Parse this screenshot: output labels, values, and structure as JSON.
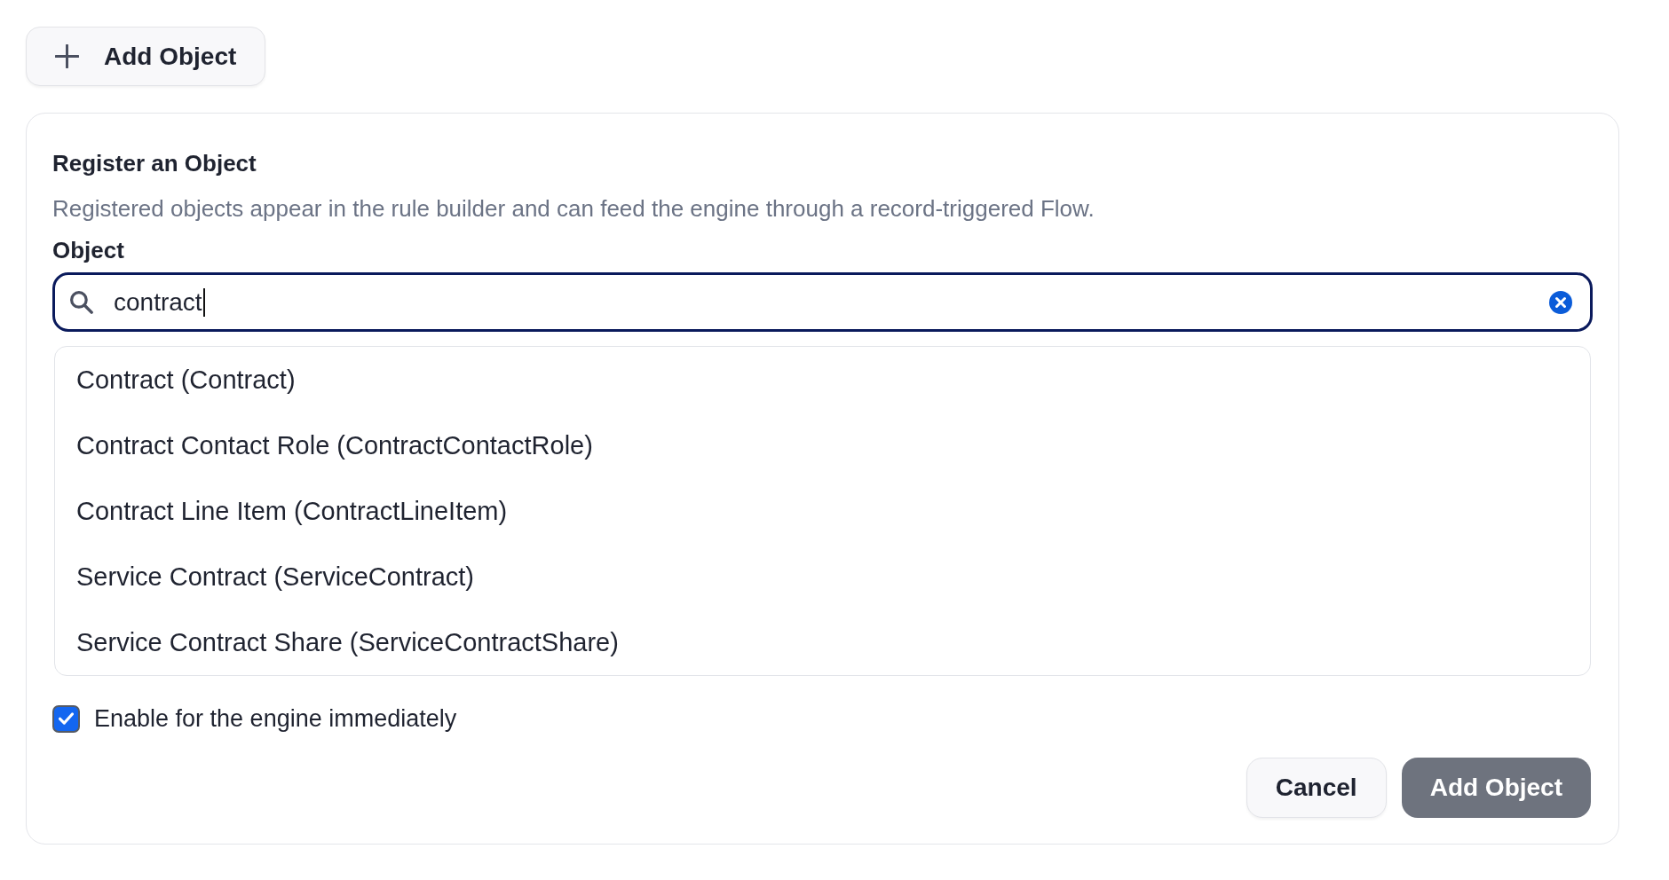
{
  "add_button": {
    "label": "Add Object"
  },
  "form": {
    "title": "Register an Object",
    "description": "Registered objects appear in the rule builder and can feed the engine through a record-triggered Flow.",
    "field_label": "Object",
    "search": {
      "value": "contract",
      "focused": true
    },
    "options": [
      {
        "label": "Contract (Contract)",
        "selected": false
      },
      {
        "label": "Contract Contact Role (ContractContactRole)",
        "selected": false
      },
      {
        "label": "Contract Line Item (ContractLineItem)",
        "selected": false
      },
      {
        "label": "Service Contract (ServiceContract)",
        "selected": false
      },
      {
        "label": "Service Contract Share (ServiceContractShare)",
        "selected": false
      }
    ],
    "checkbox": {
      "label": "Enable for the engine immediately",
      "checked": true
    },
    "actions": [
      {
        "label": "Cancel",
        "kind": "secondary",
        "disabled": false
      },
      {
        "label": "Add Object",
        "kind": "primary",
        "disabled": true
      }
    ]
  }
}
